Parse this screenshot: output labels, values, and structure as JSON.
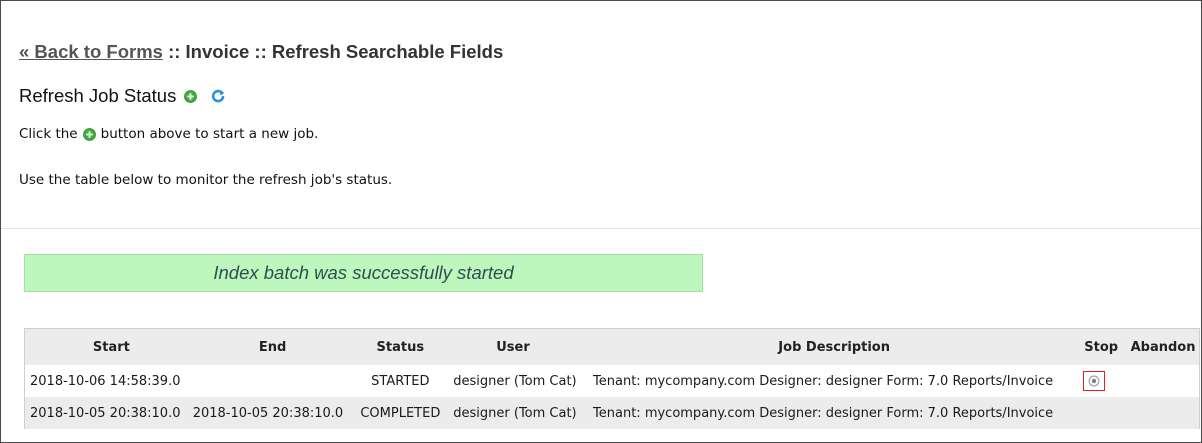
{
  "header": {
    "back_link": "« Back to Forms",
    "breadcrumb_rest": " :: Invoice :: Refresh Searchable Fields"
  },
  "section": {
    "title": "Refresh Job Status"
  },
  "instructions": {
    "line1_before": "Click the",
    "line1_after": "button above to start a new job.",
    "line2": "Use the table below to monitor the refresh job's status."
  },
  "banner": {
    "message": "Index batch was successfully started"
  },
  "table": {
    "columns": [
      "Start",
      "End",
      "Status",
      "User",
      "Job Description",
      "Stop",
      "Abandon"
    ],
    "rows": [
      {
        "start": "2018-10-06 14:58:39.0",
        "end": "",
        "status": "STARTED",
        "user": "designer (Tom Cat)",
        "description": "Tenant: mycompany.com Designer: designer Form: 7.0 Reports/Invoice",
        "has_stop": true
      },
      {
        "start": "2018-10-05 20:38:10.0",
        "end": "2018-10-05 20:38:10.0",
        "status": "COMPLETED",
        "user": "designer (Tom Cat)",
        "description": "Tenant: mycompany.com Designer: designer Form: 7.0 Reports/Invoice",
        "has_stop": false
      }
    ]
  },
  "colors": {
    "banner_bg": "#bdf7bd",
    "add_icon": "#3fae3f",
    "refresh_icon": "#2e8fe0",
    "stop_highlight": "#e02020"
  },
  "icons": [
    "add-icon",
    "refresh-icon",
    "stop-icon"
  ]
}
